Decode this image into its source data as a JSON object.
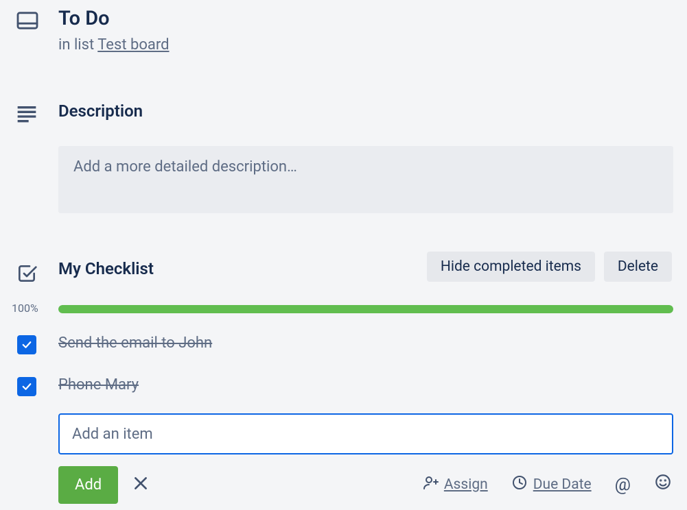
{
  "card": {
    "title": "To Do",
    "sub_prefix": "in list ",
    "list_name": "Test board"
  },
  "description": {
    "label": "Description",
    "placeholder": "Add a more detailed description…"
  },
  "checklist": {
    "title": "My Checklist",
    "hide_label": "Hide completed items",
    "delete_label": "Delete",
    "progress_label": "100%",
    "progress_percent": 100,
    "items": [
      {
        "text": "Send the email to John",
        "checked": true
      },
      {
        "text": "Phone Mary",
        "checked": true
      }
    ],
    "add_placeholder": "Add an item",
    "add_button": "Add",
    "assign_label": "Assign",
    "due_label": "Due Date"
  }
}
